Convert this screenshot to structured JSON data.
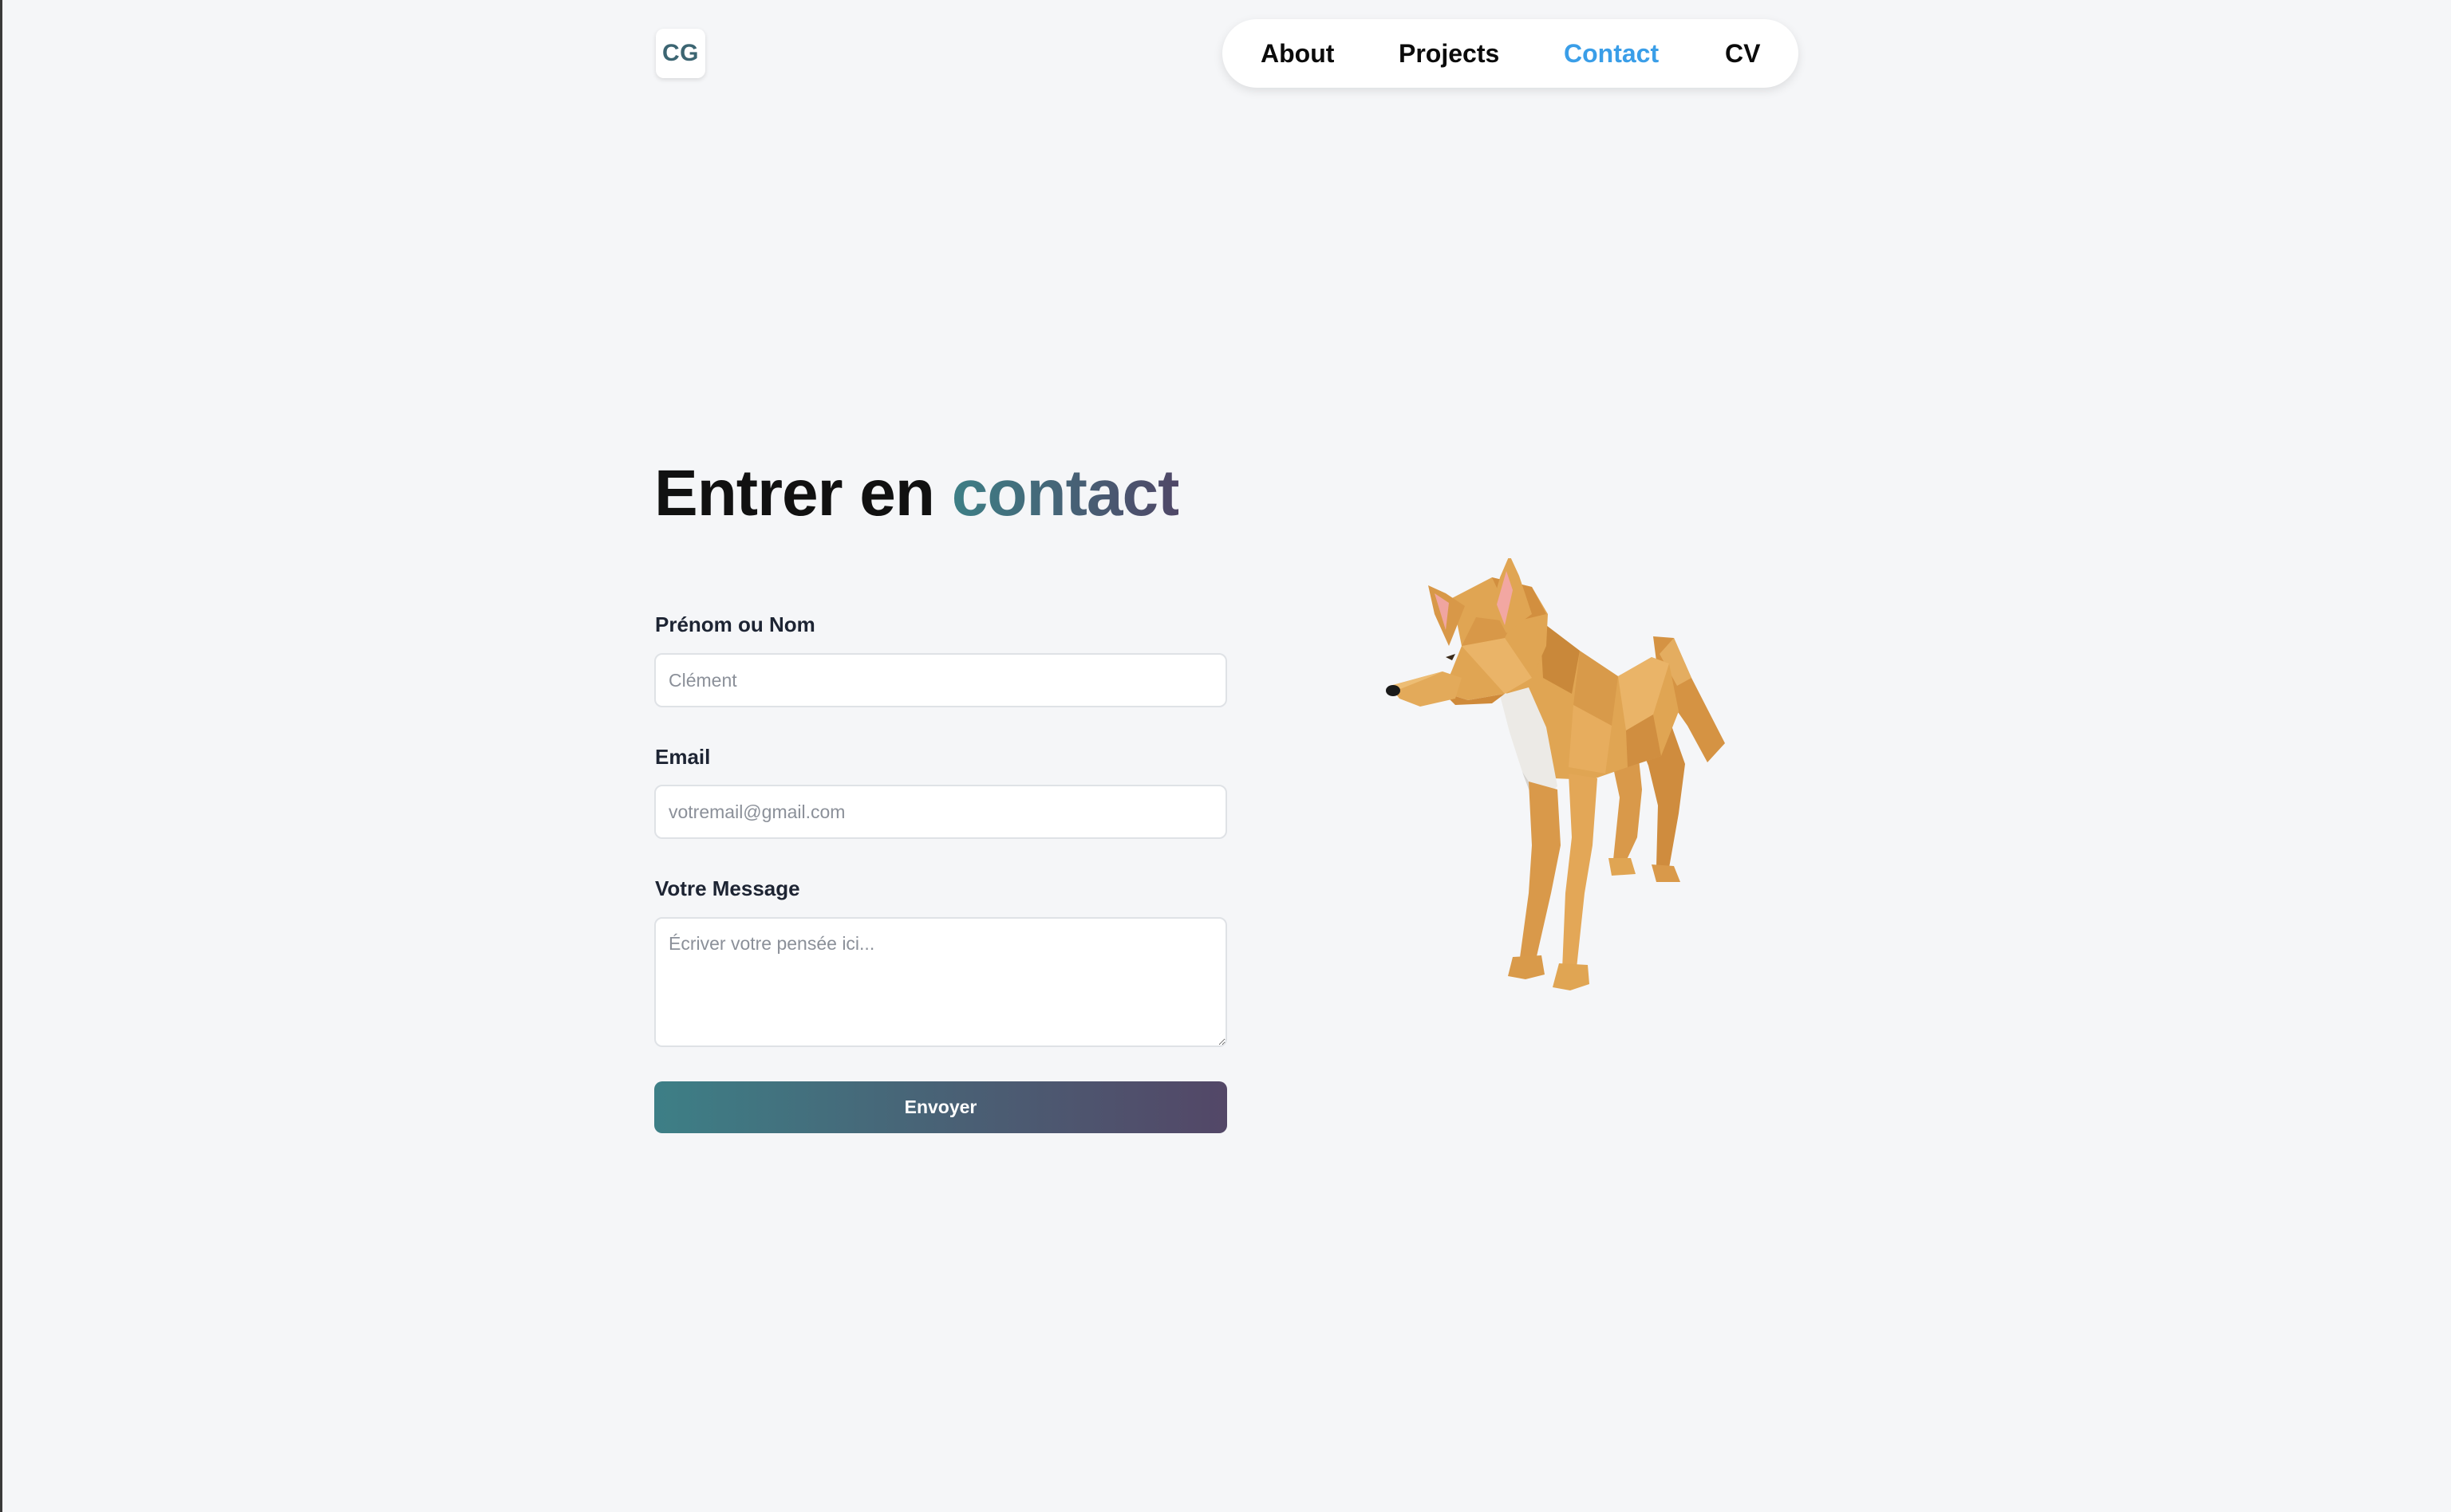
{
  "logo": {
    "text": "CG"
  },
  "nav": {
    "items": [
      {
        "label": "About",
        "active": false
      },
      {
        "label": "Projects",
        "active": false
      },
      {
        "label": "Contact",
        "active": true
      },
      {
        "label": "CV",
        "active": false
      }
    ],
    "active_color": "#3a9ee8"
  },
  "heading": {
    "prefix": "Entrer en",
    "accent": "contact"
  },
  "form": {
    "name": {
      "label": "Prénom ou Nom",
      "placeholder": "Clément",
      "value": ""
    },
    "email": {
      "label": "Email",
      "placeholder": "votremail@gmail.com",
      "value": ""
    },
    "message": {
      "label": "Votre Message",
      "placeholder": "Écriver votre pensée ici...",
      "value": ""
    },
    "submit_label": "Envoyer"
  },
  "illustration": {
    "icon": "low-poly-fox-icon"
  },
  "colors": {
    "background": "#f5f6f8",
    "gradient_start": "#3d7f86",
    "gradient_end": "#534767",
    "fox": "#e0a553"
  }
}
